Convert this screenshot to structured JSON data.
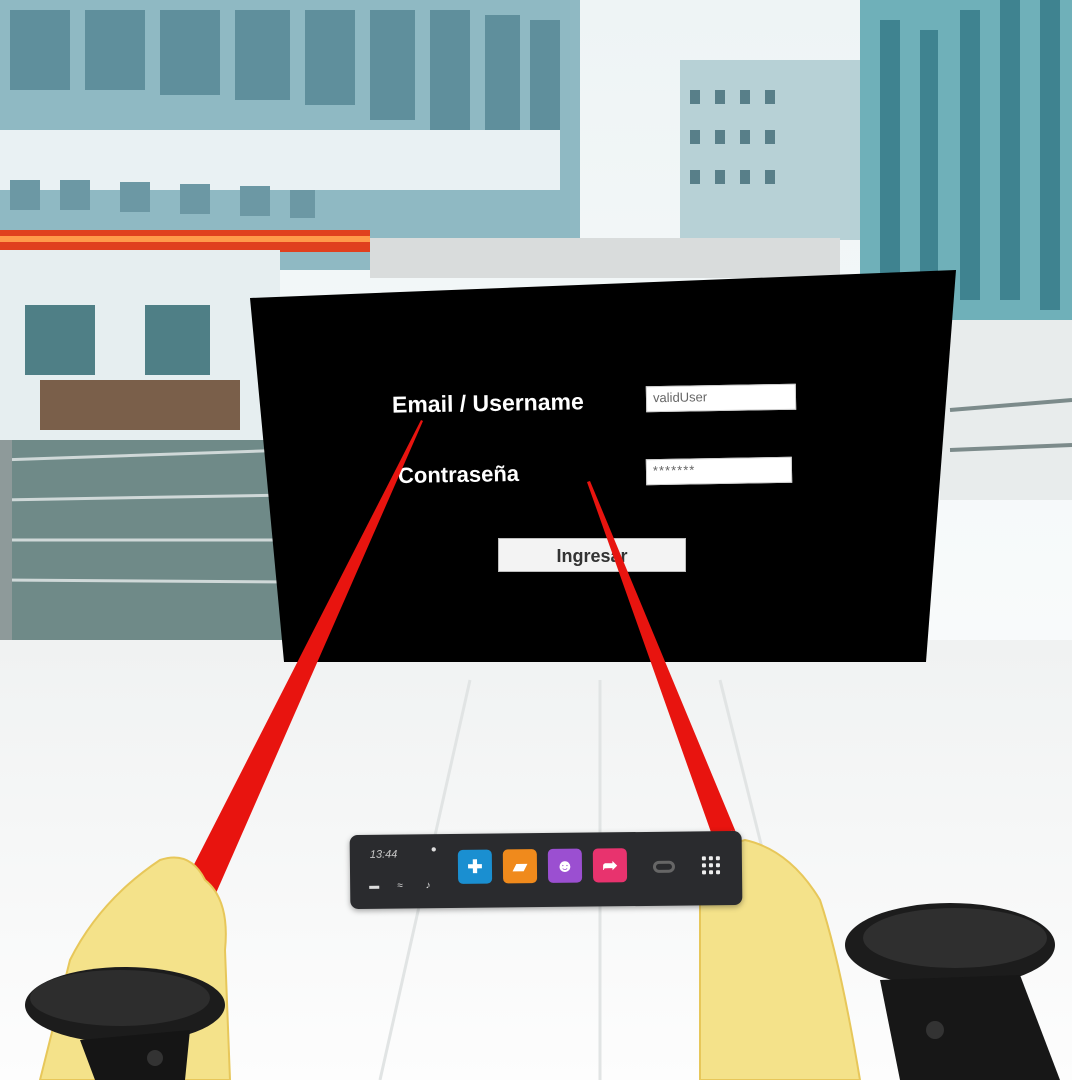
{
  "login_form": {
    "email_label": "Email / Username",
    "email_value": "validUser",
    "password_label": "Contraseña",
    "password_value": "*******",
    "submit_label": "Ingresar"
  },
  "dock": {
    "time": "13:44",
    "apps": [
      {
        "name": "explore",
        "color": "#1a8fd1",
        "glyph": "✚"
      },
      {
        "name": "store",
        "color": "#f08a1c",
        "glyph": "▰"
      },
      {
        "name": "people",
        "color": "#9b4fd1",
        "glyph": "☻"
      },
      {
        "name": "share",
        "color": "#e8336e",
        "glyph": "➦"
      }
    ]
  },
  "colors": {
    "panel": "#000000",
    "laser": "#e8140f",
    "hand": "#f4e28a",
    "dock": "#2a2b2e"
  }
}
